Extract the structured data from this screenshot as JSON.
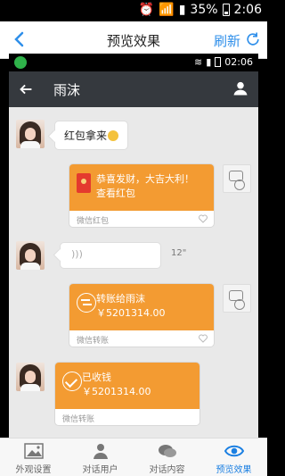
{
  "status_bar": {
    "battery_percent": "35%",
    "time": "2:06"
  },
  "app_bar": {
    "title": "预览效果",
    "refresh_label": "刷新"
  },
  "preview": {
    "status_time": "02:06",
    "chat_header": {
      "name": "雨沫"
    },
    "messages": [
      {
        "type": "text",
        "side": "left",
        "text": "红包拿来"
      },
      {
        "type": "red_packet",
        "side": "right",
        "line1": "恭喜发财，大吉大利！",
        "line2": "查看红包",
        "footer": "微信红包"
      },
      {
        "type": "voice",
        "side": "left",
        "duration": "12\""
      },
      {
        "type": "transfer",
        "side": "right",
        "title": "转账给雨沫",
        "amount": "￥5201314.00",
        "footer": "微信转账"
      },
      {
        "type": "received",
        "side": "left",
        "title": "已收钱",
        "amount": "￥5201314.00",
        "footer": "微信转账"
      }
    ]
  },
  "tabs": [
    {
      "label": "外观设置",
      "icon": "image-icon",
      "active": false
    },
    {
      "label": "对话用户",
      "icon": "user-icon",
      "active": false
    },
    {
      "label": "对话内容",
      "icon": "chat-icon",
      "active": false
    },
    {
      "label": "预览效果",
      "icon": "eye-icon",
      "active": true
    }
  ],
  "colors": {
    "accent": "#1a7fe2",
    "wechat_orange": "#f39b32",
    "chat_header_bg": "#35393e",
    "chat_bg": "#e9e9e9"
  }
}
